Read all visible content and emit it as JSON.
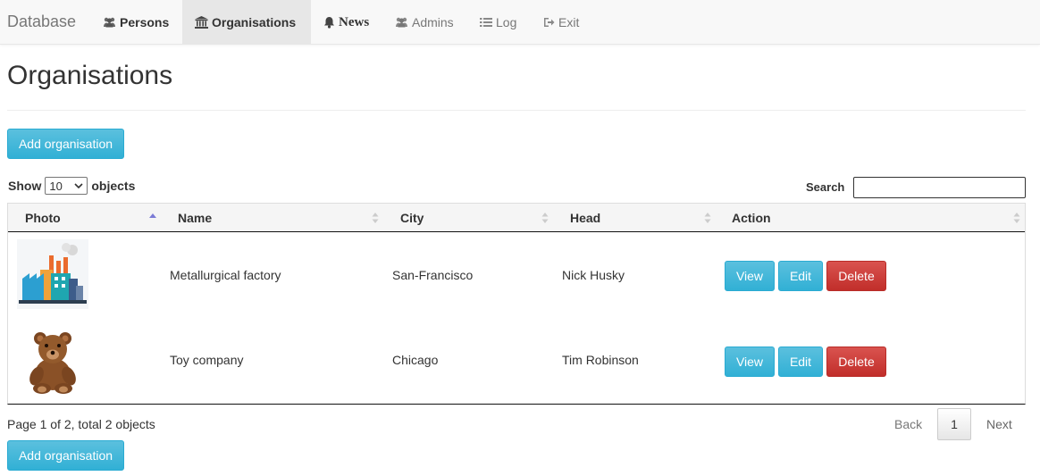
{
  "nav": {
    "brand": "Database",
    "items": [
      {
        "label": "Persons",
        "icon": "users-icon"
      },
      {
        "label": "Organisations",
        "icon": "bank-icon"
      },
      {
        "label": "News",
        "icon": "bell-icon"
      },
      {
        "label": "Admins",
        "icon": "users-icon"
      },
      {
        "label": "Log",
        "icon": "list-icon"
      },
      {
        "label": "Exit",
        "icon": "logout-icon"
      }
    ]
  },
  "page": {
    "title": "Organisations",
    "add_button": "Add organisation"
  },
  "list_controls": {
    "show_label": "Show",
    "page_size": "10",
    "objects_label": "objects",
    "search_label": "Search",
    "search_value": ""
  },
  "table": {
    "columns": [
      "Photo",
      "Name",
      "City",
      "Head",
      "Action"
    ],
    "rows": [
      {
        "photo": "factory-image",
        "name": "Metallurgical factory",
        "city": "San-Francisco",
        "head": "Nick Husky"
      },
      {
        "photo": "teddy-bear-image",
        "name": "Toy company",
        "city": "Chicago",
        "head": "Tim Robinson"
      }
    ],
    "actions": {
      "view": "View",
      "edit": "Edit",
      "delete": "Delete"
    }
  },
  "pagination": {
    "info": "Page 1 of 2, total 2 objects",
    "back": "Back",
    "current": "1",
    "next": "Next"
  },
  "colors": {
    "info": "#5bc0de",
    "danger": "#d9534f",
    "sort_active": "#7b7bd6"
  }
}
